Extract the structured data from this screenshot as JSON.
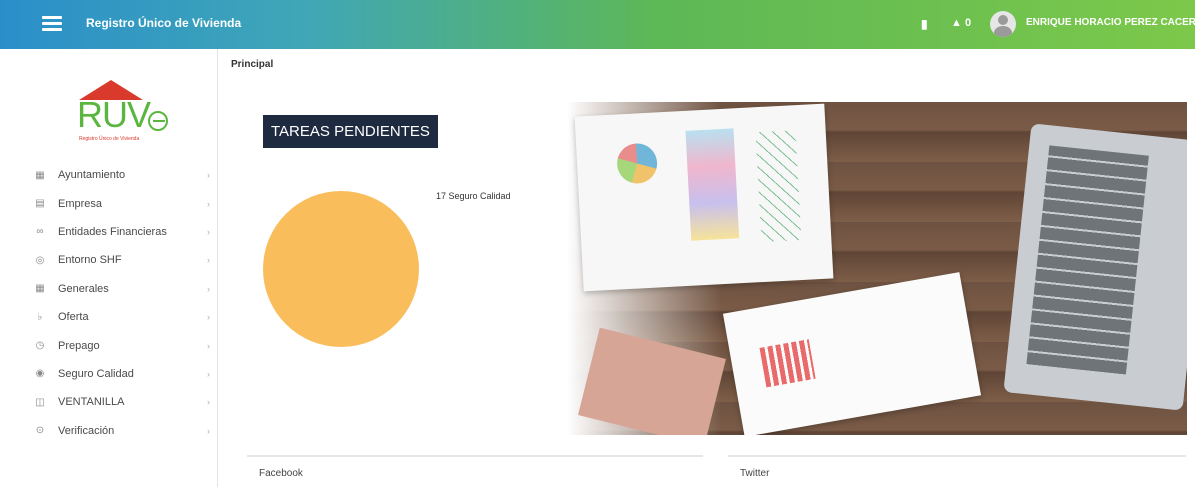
{
  "header": {
    "app_title": "Registro Único de Vivienda",
    "alerts_count": "0",
    "user_name": "ENRIQUE HORACIO PEREZ CACERES",
    "accent_color": "#5db856"
  },
  "sidebar": {
    "logo_text": "RUV",
    "logo_tagline": "Registro Único de Vivienda",
    "items": [
      {
        "label": "Ayuntamiento",
        "icon": "building-icon"
      },
      {
        "label": "Empresa",
        "icon": "briefcase-icon"
      },
      {
        "label": "Entidades Financieras",
        "icon": "users-icon"
      },
      {
        "label": "Entorno SHF",
        "icon": "globe-icon"
      },
      {
        "label": "Generales",
        "icon": "grid-icon"
      },
      {
        "label": "Oferta",
        "icon": "tag-icon"
      },
      {
        "label": "Prepago",
        "icon": "clock-icon"
      },
      {
        "label": "Seguro Calidad",
        "icon": "shield-icon"
      },
      {
        "label": "VENTANILLA",
        "icon": "window-icon"
      },
      {
        "label": "Verificación",
        "icon": "check-circle-icon"
      }
    ]
  },
  "breadcrumb": "Principal",
  "main": {
    "tasks_button": "TAREAS PENDIENTES",
    "pie_label": "17 Seguro Calidad",
    "pie_color": "#f9bd5b",
    "pending": [
      {
        "count": 17,
        "category": "Seguro Calidad"
      }
    ]
  },
  "cards": {
    "facebook": "Facebook",
    "twitter": "Twitter"
  }
}
